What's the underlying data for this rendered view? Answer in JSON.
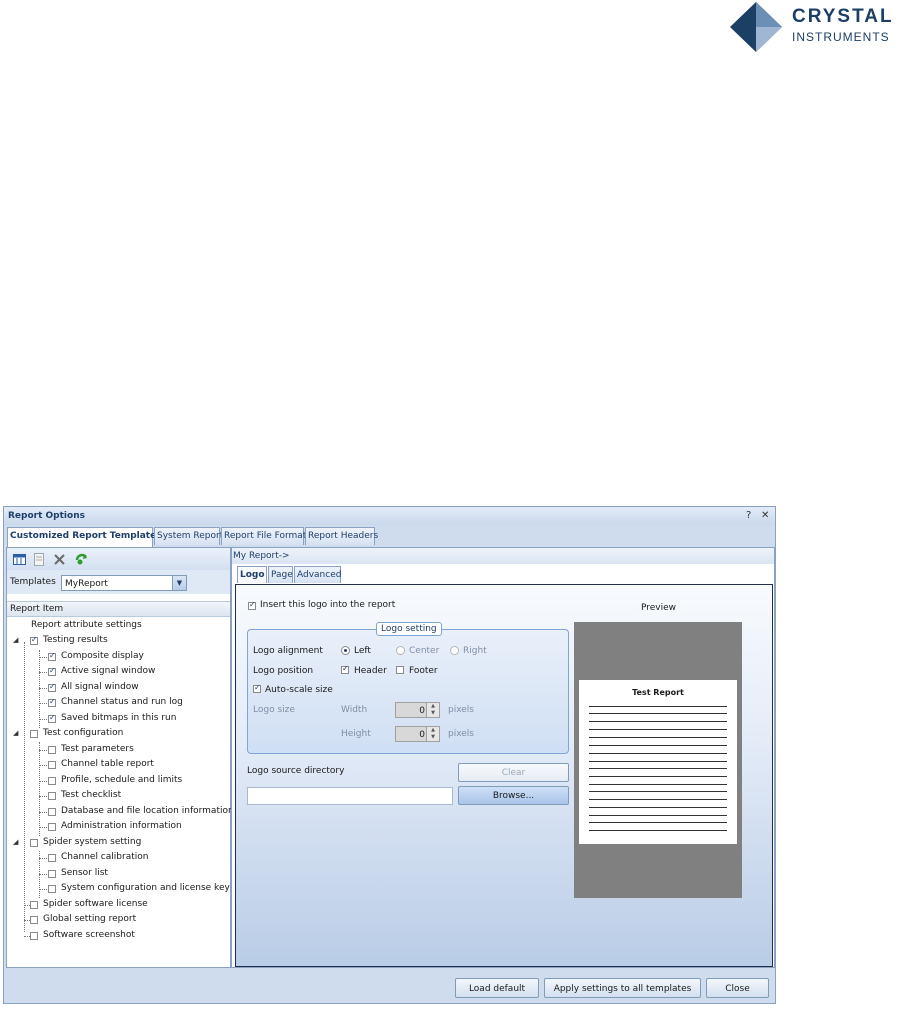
{
  "brand": {
    "line1": "CRYSTAL",
    "line2": "INSTRUMENTS"
  },
  "dialog": {
    "title": "Report Options",
    "help": "?",
    "close": "✕",
    "tabs": [
      "Customized Report Template",
      "System Report",
      "Report File Format",
      "Report Headers"
    ],
    "templates_label": "Templates",
    "template_value": "MyReport",
    "report_item_header": "Report Item",
    "tree": {
      "attr": "Report attribute settings",
      "testing_results": "Testing results",
      "composite": "Composite display",
      "active": "Active signal window",
      "all": "All signal window",
      "channel_status": "Channel status and run log",
      "bitmaps": "Saved bitmaps in this run",
      "test_config": "Test configuration",
      "test_params": "Test parameters",
      "channel_table": "Channel table report",
      "profile": "Profile, schedule and limits",
      "checklist": "Test checklist",
      "database": "Database and file location information",
      "admin": "Administration information",
      "spider": "Spider system setting",
      "calibration": "Channel calibration",
      "sensor": "Sensor list",
      "sysconfig": "System configuration and license key",
      "license": "Spider software license",
      "global": "Global setting report",
      "screenshot": "Software screenshot"
    },
    "breadcrumb": "My Report->",
    "subtabs": [
      "Logo",
      "Page",
      "Advanced"
    ],
    "logo": {
      "insert": "Insert this logo into the report",
      "group_title": "Logo setting",
      "alignment_label": "Logo alignment",
      "left": "Left",
      "center": "Center",
      "right": "Right",
      "position_label": "Logo position",
      "header": "Header",
      "footer": "Footer",
      "autoscale": "Auto-scale size",
      "size_label": "Logo size",
      "width_label": "Width",
      "height_label": "Height",
      "width_value": "0",
      "height_value": "0",
      "units": "pixels",
      "source_label": "Logo source directory",
      "clear": "Clear",
      "browse": "Browse...",
      "preview_label": "Preview",
      "preview_title": "Test Report"
    },
    "footer": {
      "load_default": "Load default",
      "apply_all": "Apply settings to all templates",
      "close": "Close"
    }
  }
}
